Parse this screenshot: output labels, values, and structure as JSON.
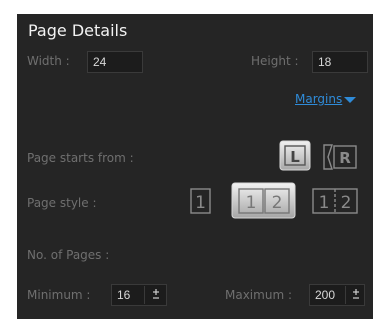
{
  "title": "Page Details",
  "width": {
    "label": "Width :",
    "value": "24"
  },
  "height": {
    "label": "Height :",
    "value": "18"
  },
  "margins_link": "Margins",
  "page_starts": {
    "label": "Page starts from :",
    "left": "L",
    "right": "R",
    "selected": "L"
  },
  "page_style": {
    "label": "Page style :",
    "single": "1",
    "spread_left": "1",
    "spread_right": "2",
    "selected": "spread"
  },
  "pages": {
    "heading": "No. of Pages :",
    "minimum_label": "Minimum :",
    "minimum_value": "16",
    "maximum_label": "Maximum :",
    "maximum_value": "200",
    "stepper_up": "+",
    "stepper_down": "-"
  },
  "colors": {
    "panel": "#252525",
    "link": "#2f8bd8",
    "label": "#6f6f6f",
    "title": "#f2f2f2"
  }
}
